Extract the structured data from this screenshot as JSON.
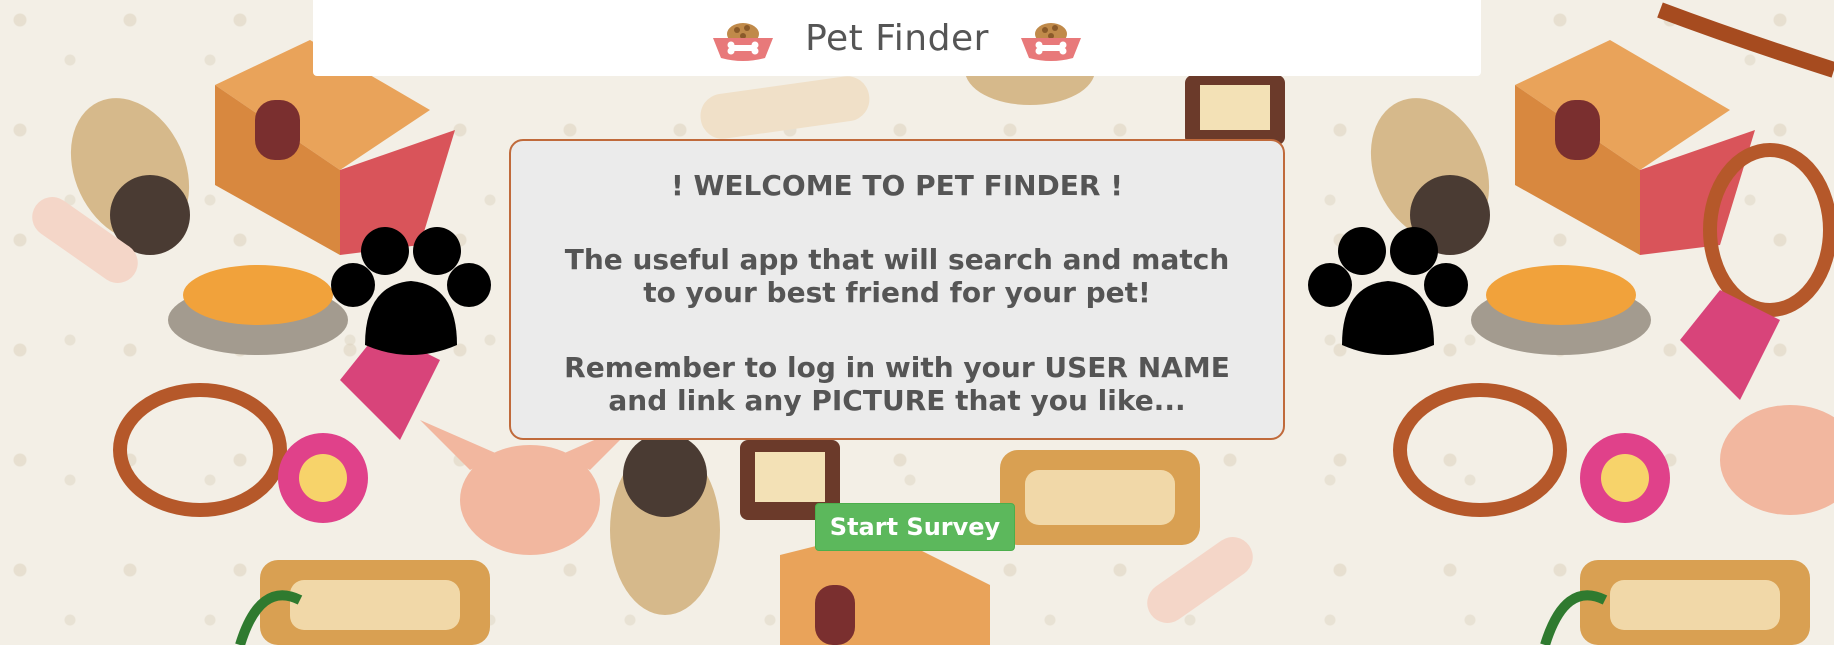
{
  "navbar": {
    "title": "Pet Finder",
    "left_icon": "dog-food-bowl-icon",
    "right_icon": "dog-food-bowl-icon"
  },
  "welcome": {
    "heading": "! WELCOME TO PET FINDER !",
    "description": "The useful app that will search and match to your best friend for your pet!",
    "note": "Remember to log in with your USER NAME and link any PICTURE that you like..."
  },
  "decorations": {
    "left_icon": "paw-print-icon",
    "right_icon": "paw-print-icon"
  },
  "actions": {
    "start_label": "Start Survey"
  },
  "colors": {
    "button": "#5cb85c",
    "card_border": "#c06a3b",
    "card_background": "#ebebeb",
    "bowl": "#e8797a"
  }
}
